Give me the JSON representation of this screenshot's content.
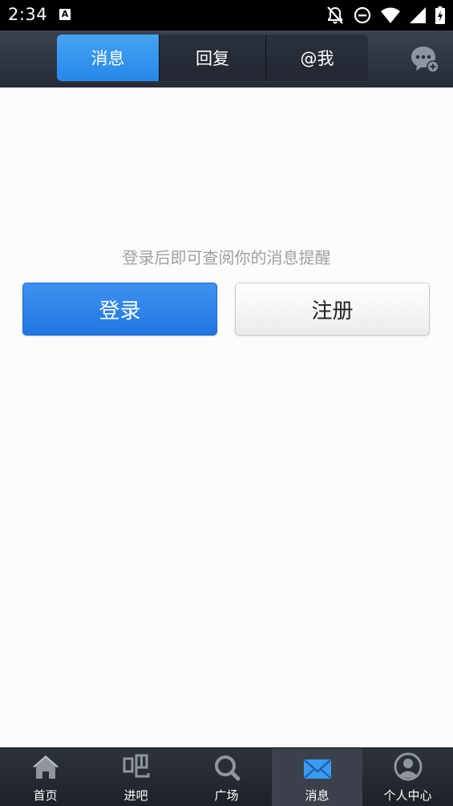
{
  "status_bar": {
    "time": "2:34",
    "notification_icon": "text-a-icon",
    "icons": [
      "notifications-off-icon",
      "do-not-disturb-icon",
      "wifi-icon",
      "signal-icon",
      "battery-charging-icon"
    ]
  },
  "header": {
    "tabs": [
      {
        "label": "消息",
        "active": true
      },
      {
        "label": "回复",
        "active": false
      },
      {
        "label": "@我",
        "active": false
      }
    ],
    "action_icon": "chat-add-icon",
    "accent_color": "#2f8cec"
  },
  "main": {
    "hint": "登录后即可查阅你的消息提醒",
    "login_label": "登录",
    "register_label": "注册"
  },
  "bottom_nav": {
    "items": [
      {
        "label": "首页",
        "icon": "home-icon",
        "active": false
      },
      {
        "label": "进吧",
        "icon": "enter-bar-icon",
        "active": false
      },
      {
        "label": "广场",
        "icon": "search-icon",
        "active": false
      },
      {
        "label": "消息",
        "icon": "mail-icon",
        "active": true
      },
      {
        "label": "个人中心",
        "icon": "user-profile-icon",
        "active": false
      }
    ]
  }
}
